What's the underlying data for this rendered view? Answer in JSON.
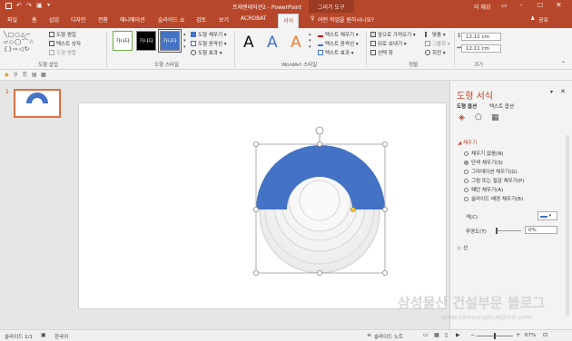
{
  "title": {
    "document": "프레젠테이션2 - PowerPoint",
    "context": "그리기 도구",
    "user": "이 혜강"
  },
  "tabs": [
    "파일",
    "홈",
    "삽입",
    "디자인",
    "전환",
    "애니메이션",
    "슬라이드 쇼",
    "검토",
    "보기",
    "ACROBAT",
    "서식"
  ],
  "active_tab": "서식",
  "tell_me": "어떤 작업을 원하시나요?",
  "share": "공유",
  "ribbon": {
    "insert_shapes": {
      "label": "도형 삽입",
      "edit_shape": "도형 편집",
      "text_box": "텍스트 상자",
      "merge_shapes": "도형 병합"
    },
    "shape_styles": {
      "label": "도형 스타일",
      "swatches": [
        "가나다",
        "가나다",
        "가나다"
      ],
      "fill": "도형 채우기",
      "outline": "도형 윤곽선",
      "effects": "도형 효과"
    },
    "wordart": {
      "label": "WordArt 스타일",
      "letters": [
        "A",
        "A",
        "A"
      ],
      "text_fill": "텍스트 채우기",
      "text_outline": "텍스트 윤곽선",
      "text_effects": "텍스트 효과"
    },
    "arrange": {
      "label": "정렬",
      "bring_forward": "앞으로 가져오기",
      "send_backward": "뒤로 보내기",
      "selection_pane": "선택 창",
      "align": "맞춤",
      "group": "그룹화",
      "rotate": "회전"
    },
    "size": {
      "label": "크기",
      "height": "12.11 cm",
      "width": "12.11 cm"
    }
  },
  "slide_number": "1",
  "format_pane": {
    "title": "도형 서식",
    "tabs": [
      "도형 옵션",
      "텍스트 옵션"
    ],
    "section": "채우기",
    "options": [
      "채우기 없음(N)",
      "단색 채우기(S)",
      "그라데이션 채우기(G)",
      "그림 또는 질감 채우기(P)",
      "패턴 채우기(A)",
      "슬라이드 배경 채우기(B)"
    ],
    "selected_option": 1,
    "color_label": "색(C)",
    "transparency_label": "투명도(T)",
    "transparency_value": "0%",
    "line_section": "선"
  },
  "shape": {
    "fill_color": "#4472c4",
    "ring_color": "#f0f0f0",
    "ring_stroke": "#d4d4d4"
  },
  "status": {
    "slide": "슬라이드 1/1",
    "language": "한국어",
    "notes": "슬라이드 노트",
    "zoom": "67%"
  },
  "watermark": {
    "main": "삼성물산 건설부문 블로그",
    "url": "www.samsungblueprint.com"
  },
  "colors": {
    "accent": "#b7472a",
    "pane_title": "#b7472a"
  }
}
